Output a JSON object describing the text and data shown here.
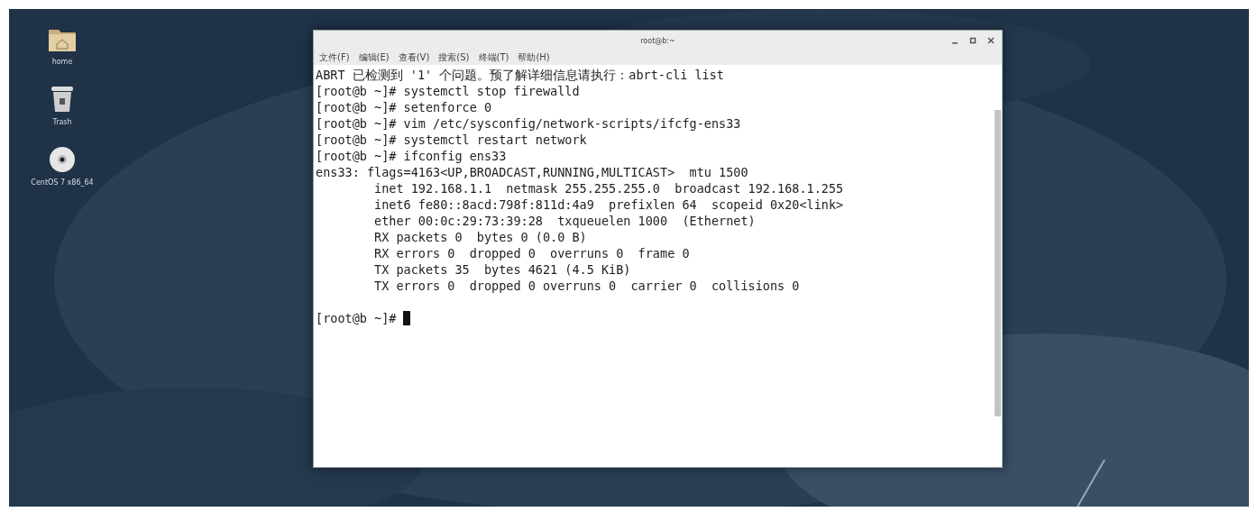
{
  "desktop": {
    "icons": [
      {
        "kind": "folder",
        "label": "home"
      },
      {
        "kind": "trash",
        "label": "Trash"
      },
      {
        "kind": "disc",
        "label": "CentOS 7 x86_64"
      }
    ]
  },
  "window": {
    "title": "root@b:~",
    "menu": [
      "文件(F)",
      "编辑(E)",
      "查看(V)",
      "搜索(S)",
      "终端(T)",
      "帮助(H)"
    ],
    "terminal": {
      "lines": [
        "ABRT 已检测到 '1' 个问题。预了解详细信息请执行：abrt-cli list",
        "[root@b ~]# systemctl stop firewalld",
        "[root@b ~]# setenforce 0",
        "[root@b ~]# vim /etc/sysconfig/network-scripts/ifcfg-ens33",
        "[root@b ~]# systemctl restart network",
        "[root@b ~]# ifconfig ens33",
        "ens33: flags=4163<UP,BROADCAST,RUNNING,MULTICAST>  mtu 1500",
        "        inet 192.168.1.1  netmask 255.255.255.0  broadcast 192.168.1.255",
        "        inet6 fe80::8acd:798f:811d:4a9  prefixlen 64  scopeid 0x20<link>",
        "        ether 00:0c:29:73:39:28  txqueuelen 1000  (Ethernet)",
        "        RX packets 0  bytes 0 (0.0 B)",
        "        RX errors 0  dropped 0  overruns 0  frame 0",
        "        TX packets 35  bytes 4621 (4.5 KiB)",
        "        TX errors 0  dropped 0 overruns 0  carrier 0  collisions 0"
      ],
      "prompt": {
        "text": "[root@b ~]#",
        "cursor": true
      }
    }
  }
}
